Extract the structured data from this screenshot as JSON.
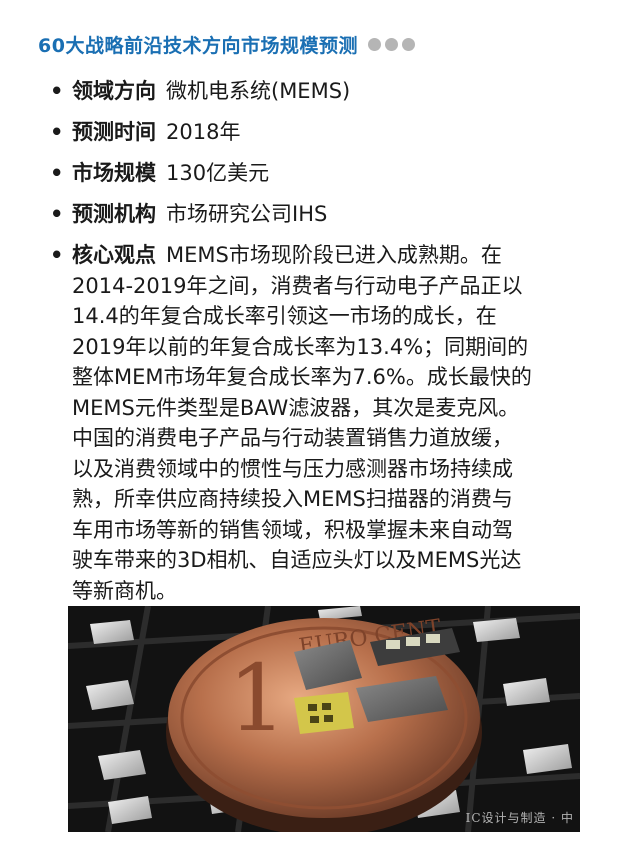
{
  "header": {
    "title": "60大战略前沿技术方向市场规模预测"
  },
  "items": [
    {
      "label": "领域方向",
      "value": "微机电系统(MEMS)"
    },
    {
      "label": "预测时间",
      "value": "2018年"
    },
    {
      "label": "市场规模",
      "value": "130亿美元"
    },
    {
      "label": "预测机构",
      "value": "市场研究公司IHS"
    }
  ],
  "core": {
    "label": "核心观点",
    "lines": [
      "MEMS市场现阶段已进入成熟期。在",
      "2014-2019年之间，消费者与行动电子产品正以",
      "14.4的年复合成长率引领这一市场的成长，在",
      "2019年以前的年复合成长率为13.4%；同期间的",
      "整体MEM市场年复合成长率为7.6%。成长最快的",
      "MEMS元件类型是BAW滤波器，其次是麦克风。",
      "中国的消费电子产品与行动装置销售力道放缓，",
      "以及消费领域中的惯性与压力感测器市场持续成",
      "熟，所幸供应商持续投入MEMS扫描器的消费与",
      "车用市场等新的销售领域，积极掌握未来自动驾",
      "驶车带来的3D相机、自适应头灯以及MEMS光达",
      "等新商机。"
    ]
  },
  "photo": {
    "coin_text": "EURO CENT",
    "coin_numeral": "1",
    "watermark": "IC设计与制造 · 中"
  }
}
